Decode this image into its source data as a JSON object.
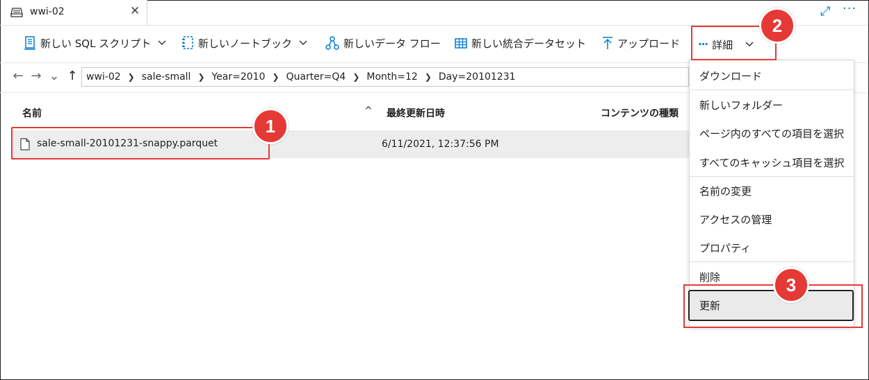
{
  "tab": {
    "title": "wwi-02",
    "close": "✕"
  },
  "window": {
    "expand": "⤢",
    "more": "···"
  },
  "toolbar": {
    "new_sql_script": "新しい SQL スクリプト",
    "new_notebook": "新しいノートブック",
    "new_data_flow": "新しいデータ フロー",
    "new_integration_dataset": "新しい統合データセット",
    "upload": "アップロード",
    "details": "詳細"
  },
  "breadcrumb": [
    "wwi-02",
    "sale-small",
    "Year=2010",
    "Quarter=Q4",
    "Month=12",
    "Day=20101231"
  ],
  "columns": {
    "name": "名前",
    "modified": "最終更新日時",
    "type": "コンテンツの種類"
  },
  "files": [
    {
      "name": "sale-small-20101231-snappy.parquet",
      "modified": "6/11/2021, 12:37:56 PM"
    }
  ],
  "menu": {
    "download": "ダウンロード",
    "new_folder": "新しいフォルダー",
    "select_all_page": "ページ内のすべての項目を選択",
    "select_all_cache": "すべてのキャッシュ項目を選択",
    "rename": "名前の変更",
    "manage_access": "アクセスの管理",
    "properties": "プロパティ",
    "delete": "削除",
    "refresh": "更新"
  },
  "callouts": [
    "1",
    "2",
    "3"
  ],
  "colors": {
    "accent": "#0078d4",
    "callout": "#e53935",
    "selected_row": "#ededed"
  }
}
